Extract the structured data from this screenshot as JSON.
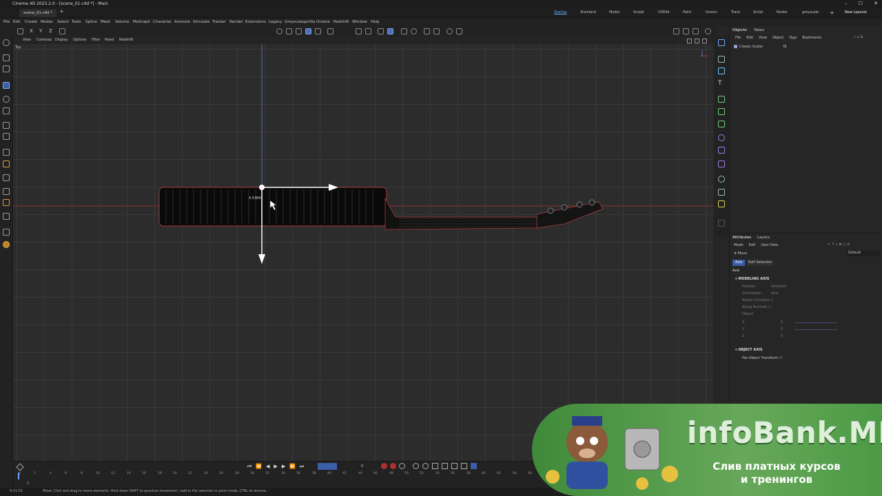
{
  "window": {
    "title": "Cinema 4D 2023.2.0 - [scene_01.c4d *] - Main",
    "controls": [
      "–",
      "☐",
      "✕"
    ]
  },
  "doc_tab": {
    "label": "scene_01.c4d *",
    "new_tab": "+"
  },
  "menu": [
    "File",
    "Edit",
    "Create",
    "Modes",
    "Select",
    "Tools",
    "Spline",
    "Mesh",
    "Volume",
    "MoGraph",
    "Character",
    "Animate",
    "Simulate",
    "Tracker",
    "Render",
    "Extensions",
    "Legacy",
    "Greyscalegorilla",
    "Octane",
    "Redshift",
    "Window",
    "Help"
  ],
  "layouts": {
    "items": [
      "Startup",
      "Standard",
      "Model",
      "Sculpt",
      "UVEdit",
      "Paint",
      "Groom",
      "Track",
      "Script",
      "Nodes",
      "greyscale"
    ],
    "add": "+",
    "new_layouts": "New Layouts"
  },
  "viewport": {
    "menu": [
      "View",
      "Cameras",
      "Display",
      "Options",
      "Filter",
      "Panel",
      "Redshift"
    ],
    "name": "Top",
    "measure": "4.5384"
  },
  "objects_panel": {
    "tabs": [
      "Objects",
      "Takes"
    ],
    "menu": [
      "File",
      "Edit",
      "View",
      "Object",
      "Tags",
      "Bookmarks"
    ],
    "object": "Classic Guitar"
  },
  "attributes_panel": {
    "tabs": [
      "Attributes",
      "Layers"
    ],
    "menu": [
      "Mode",
      "Edit",
      "User Data"
    ],
    "tool": "Move",
    "preset": "Default",
    "subtabs": [
      "Axis",
      "Soft Selection"
    ],
    "section_label": "Axis",
    "modeling_axis": "MODELING AXIS",
    "fields": [
      {
        "label": "Position",
        "value": "Selected"
      },
      {
        "label": "Orientation",
        "value": "Axis"
      },
      {
        "label": "Retain Changes",
        "value": ""
      },
      {
        "label": "Along Normals",
        "value": ""
      },
      {
        "label": "Object",
        "value": ""
      },
      {
        "label": "X",
        "value": "0"
      },
      {
        "label": "Y",
        "value": "0"
      },
      {
        "label": "Z",
        "value": "0"
      }
    ],
    "object_axis": "OBJECT AXIS",
    "per_object": "Per-Object Transform"
  },
  "timeline": {
    "ticks": [
      "0",
      "2",
      "4",
      "6",
      "8",
      "10",
      "12",
      "14",
      "16",
      "18",
      "20",
      "22",
      "24",
      "26",
      "28",
      "30",
      "32",
      "34",
      "36",
      "38",
      "40",
      "42",
      "44",
      "46",
      "48",
      "50",
      "52",
      "54",
      "56",
      "58",
      "60",
      "62",
      "64",
      "66"
    ],
    "frame": "0",
    "start": "0"
  },
  "status": {
    "left": "4:21:53",
    "message": "Move: Click and drag to move elements. Hold down SHIFT to quantize movement / add to the selection in point mode, CTRL to remove."
  },
  "promo": {
    "title": "infoBank.ME",
    "line1": "Слив платных курсов",
    "line2": "и тренингов"
  },
  "colors": {
    "accent": "#4c6fbf",
    "viewport_bg": "#2c2c2c",
    "axis_red": "#a83a3a",
    "axis_blue": "#4b6fc7"
  }
}
